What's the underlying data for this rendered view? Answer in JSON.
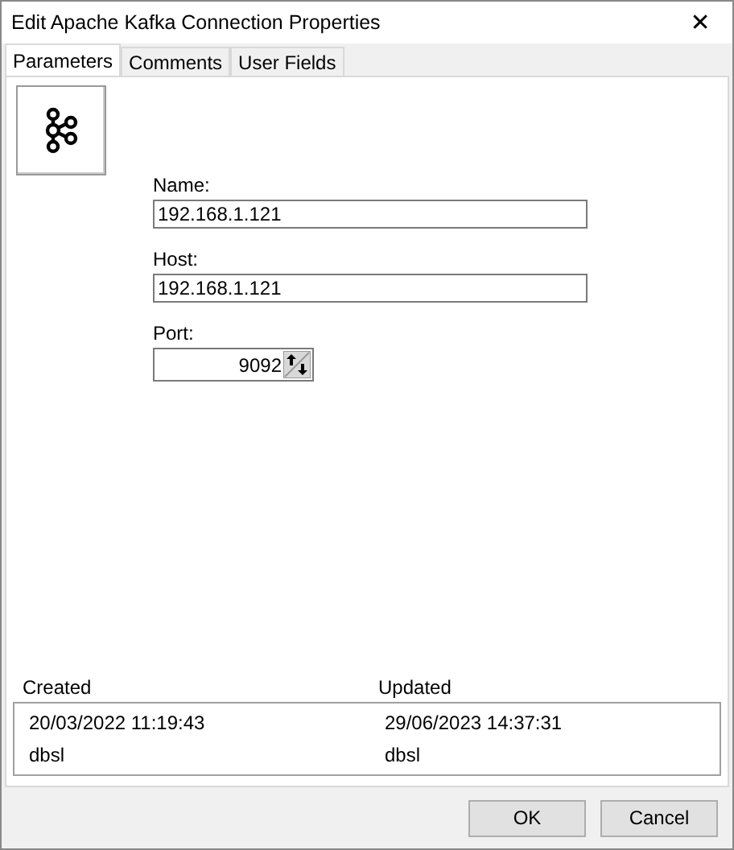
{
  "window": {
    "title": "Edit Apache Kafka Connection Properties",
    "close": "✕"
  },
  "tabs": [
    {
      "label": "Parameters",
      "selected": true
    },
    {
      "label": "Comments",
      "selected": false
    },
    {
      "label": "User Fields",
      "selected": false
    }
  ],
  "form": {
    "name": {
      "label": "Name:",
      "value": "192.168.1.121"
    },
    "host": {
      "label": "Host:",
      "value": "192.168.1.121"
    },
    "port": {
      "label": "Port:",
      "value": "9092"
    }
  },
  "audit": {
    "columns": [
      "Created",
      "Updated"
    ],
    "rows": [
      [
        "20/03/2022 11:19:43",
        "29/06/2023 14:37:31"
      ],
      [
        "dbsl",
        "dbsl"
      ]
    ]
  },
  "buttons": [
    "OK",
    "Cancel"
  ]
}
